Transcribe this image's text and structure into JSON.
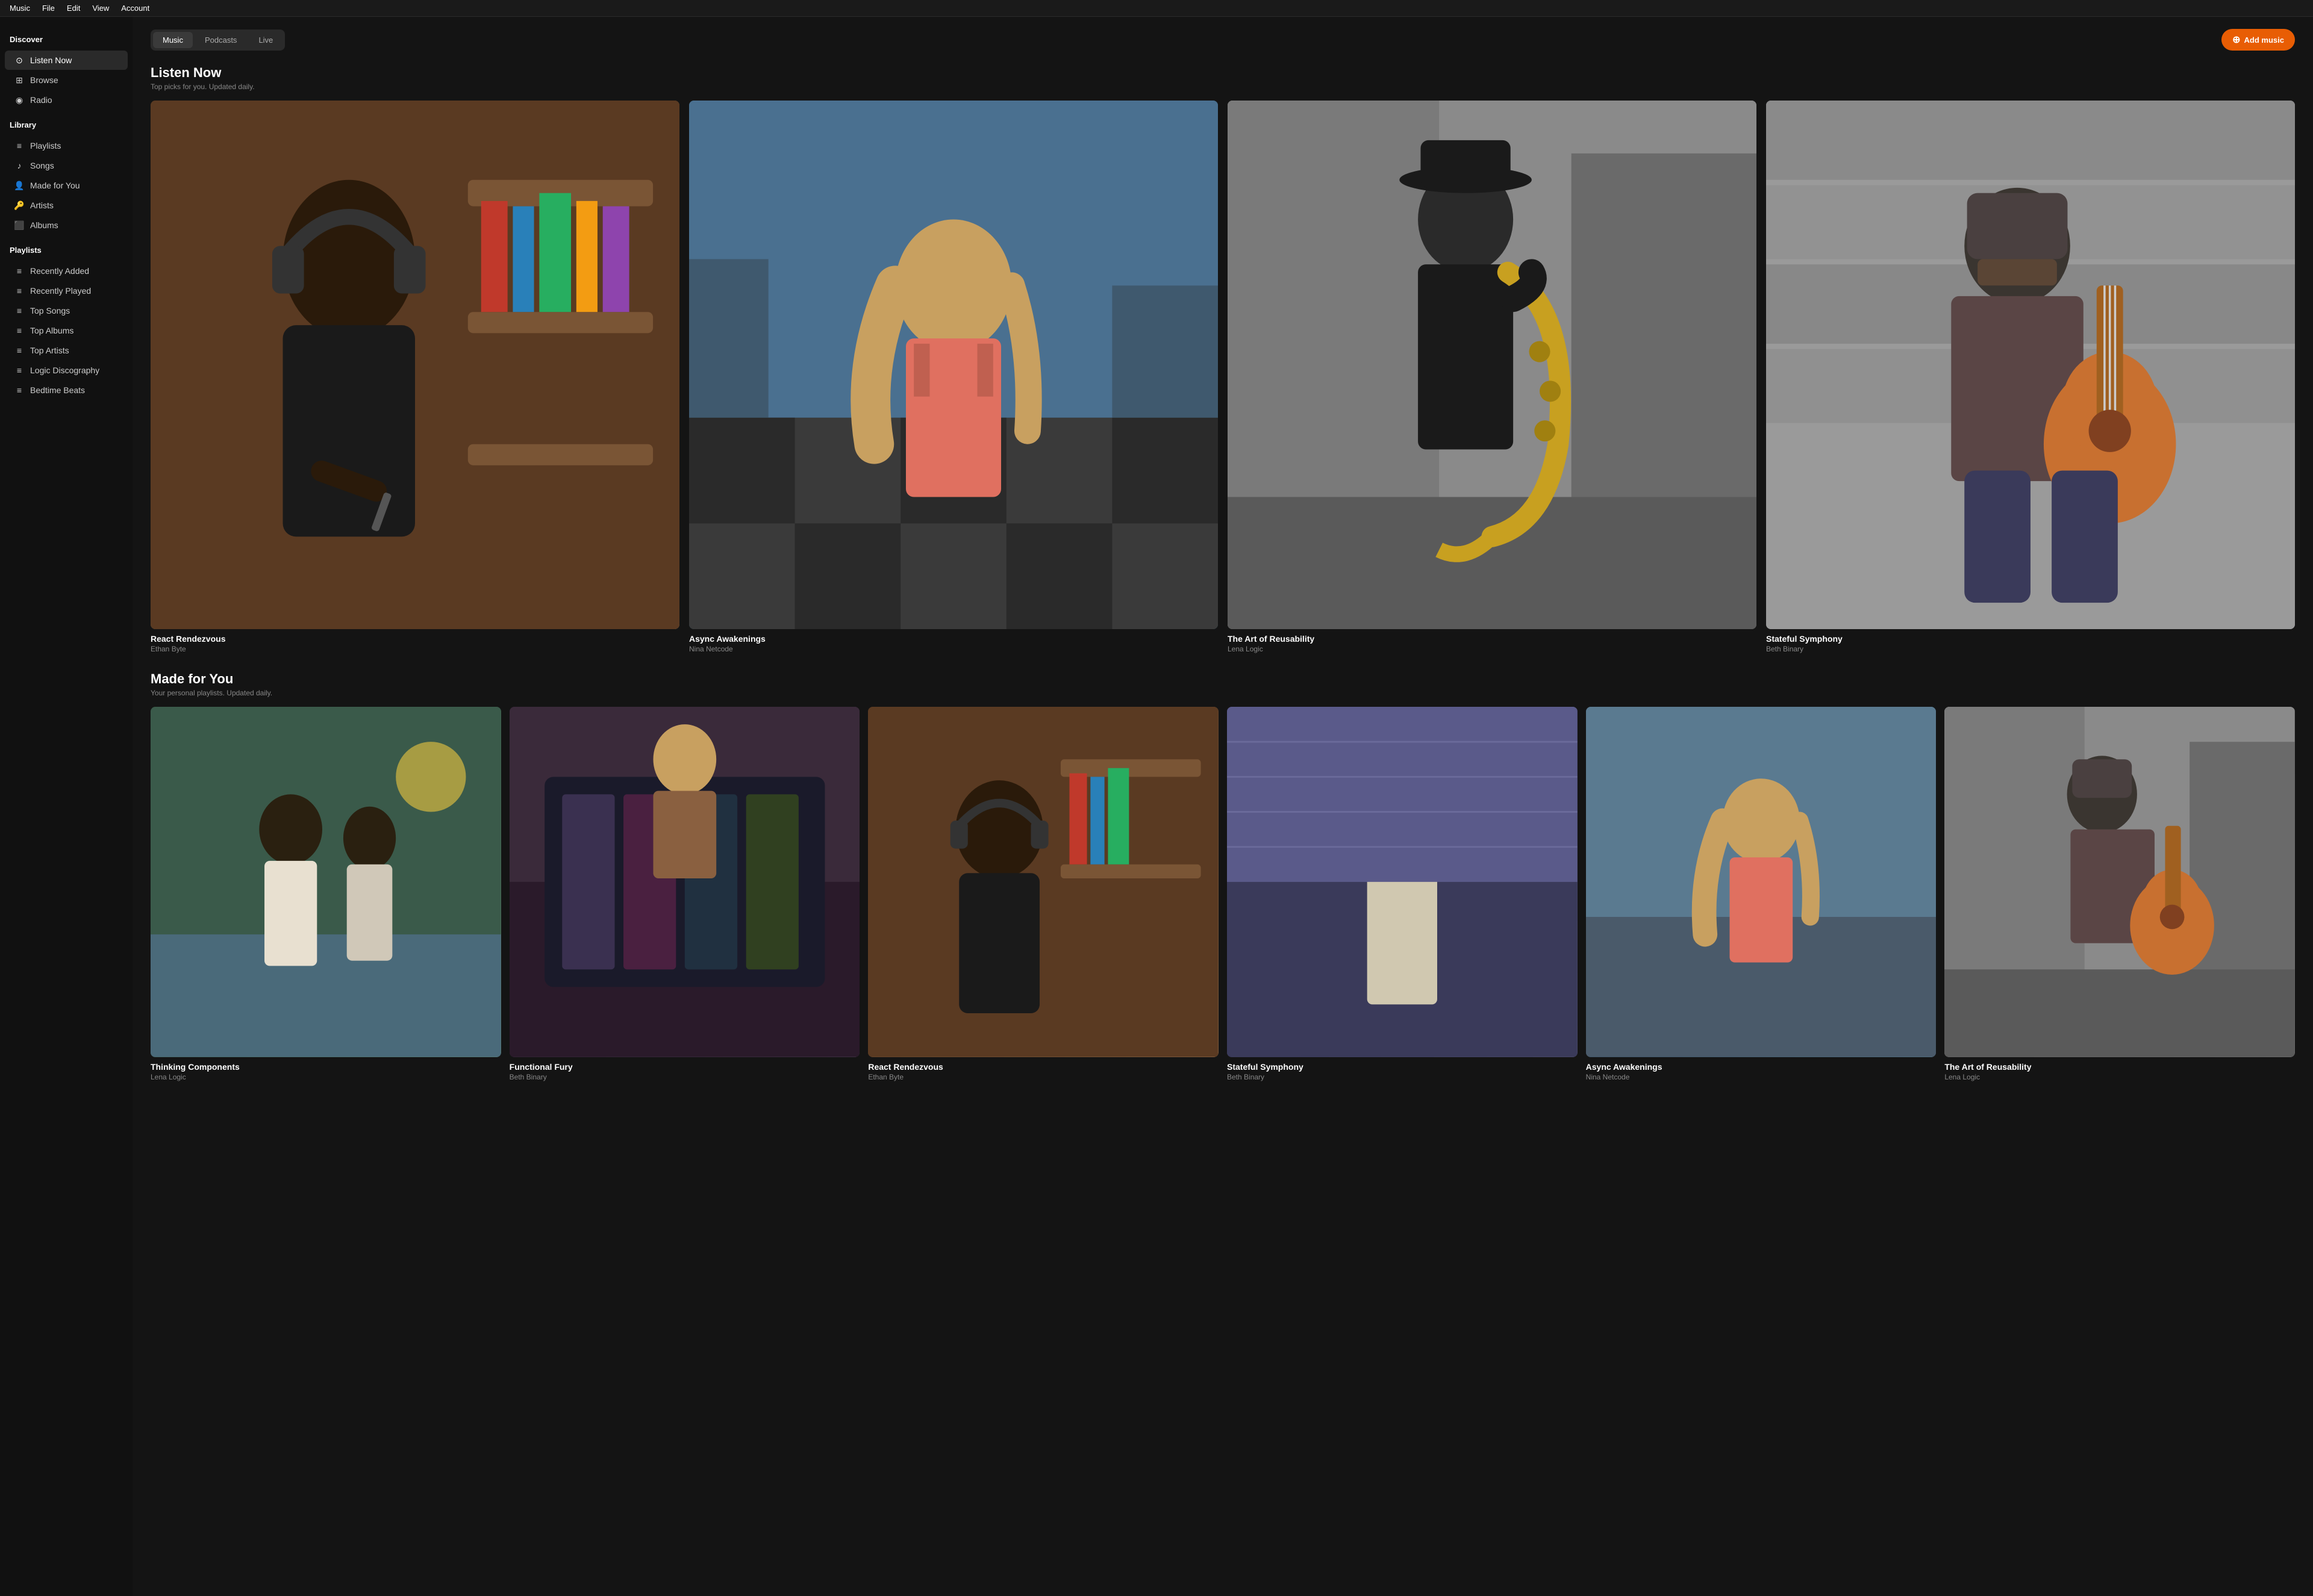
{
  "menubar": {
    "items": [
      "Music",
      "File",
      "Edit",
      "View",
      "Account"
    ]
  },
  "sidebar": {
    "discover_title": "Discover",
    "discover_items": [
      {
        "id": "listen-now",
        "label": "Listen Now",
        "icon": "⊙",
        "active": true
      },
      {
        "id": "browse",
        "label": "Browse",
        "icon": "⊞"
      },
      {
        "id": "radio",
        "label": "Radio",
        "icon": "◉"
      }
    ],
    "library_title": "Library",
    "library_items": [
      {
        "id": "playlists",
        "label": "Playlists",
        "icon": "≡"
      },
      {
        "id": "songs",
        "label": "Songs",
        "icon": "♪"
      },
      {
        "id": "made-for-you",
        "label": "Made for You",
        "icon": "👤"
      },
      {
        "id": "artists",
        "label": "Artists",
        "icon": "🔑"
      },
      {
        "id": "albums",
        "label": "Albums",
        "icon": "⬛"
      }
    ],
    "playlists_title": "Playlists",
    "playlist_items": [
      {
        "id": "recently-added",
        "label": "Recently Added",
        "icon": "≡"
      },
      {
        "id": "recently-played",
        "label": "Recently Played",
        "icon": "≡"
      },
      {
        "id": "top-songs",
        "label": "Top Songs",
        "icon": "≡"
      },
      {
        "id": "top-albums",
        "label": "Top Albums",
        "icon": "≡"
      },
      {
        "id": "top-artists",
        "label": "Top Artists",
        "icon": "≡"
      },
      {
        "id": "logic-discography",
        "label": "Logic Discography",
        "icon": "≡"
      },
      {
        "id": "bedtime-beats",
        "label": "Bedtime Beats",
        "icon": "≡"
      }
    ]
  },
  "tabs": {
    "items": [
      {
        "id": "music",
        "label": "Music",
        "active": true
      },
      {
        "id": "podcasts",
        "label": "Podcasts",
        "active": false
      },
      {
        "id": "live",
        "label": "Live",
        "active": false
      }
    ],
    "add_music_label": "Add music"
  },
  "listen_now": {
    "title": "Listen Now",
    "subtitle": "Top picks for you. Updated daily.",
    "albums": [
      {
        "id": "react-rendezvous",
        "title": "React Rendezvous",
        "artist": "Ethan Byte",
        "color": "#5a3a2a"
      },
      {
        "id": "async-awakenings",
        "title": "Async Awakenings",
        "artist": "Nina Netcode",
        "color": "#2a4a5a"
      },
      {
        "id": "art-of-reusability",
        "title": "The Art of Reusability",
        "artist": "Lena Logic",
        "color": "#4a4a4a"
      },
      {
        "id": "stateful-symphony",
        "title": "Stateful Symphony",
        "artist": "Beth Binary",
        "color": "#2a2a4a"
      }
    ]
  },
  "made_for_you": {
    "title": "Made for You",
    "subtitle": "Your personal playlists. Updated daily.",
    "albums": [
      {
        "id": "thinking-components",
        "title": "Thinking Components",
        "artist": "Lena Logic",
        "color": "#3a4a3a"
      },
      {
        "id": "functional-fury",
        "title": "Functional Fury",
        "artist": "Beth Binary",
        "color": "#2a2a3a"
      },
      {
        "id": "react-rendezvous-2",
        "title": "React Rendezvous",
        "artist": "Ethan Byte",
        "color": "#5a3a2a"
      },
      {
        "id": "stateful-symphony-2",
        "title": "Stateful Symphony",
        "artist": "Beth Binary",
        "color": "#2a2a4a"
      },
      {
        "id": "async-awakenings-2",
        "title": "Async Awakenings",
        "artist": "Nina Netcode",
        "color": "#2a4a5a"
      },
      {
        "id": "art-of-reusability-2",
        "title": "The Art of Reusability",
        "artist": "Lena Logic",
        "color": "#4a4a4a"
      }
    ]
  },
  "colors": {
    "accent": "#e85d04",
    "sidebar_bg": "#111111",
    "content_bg": "#141414",
    "active_item": "#2a2a2a"
  }
}
